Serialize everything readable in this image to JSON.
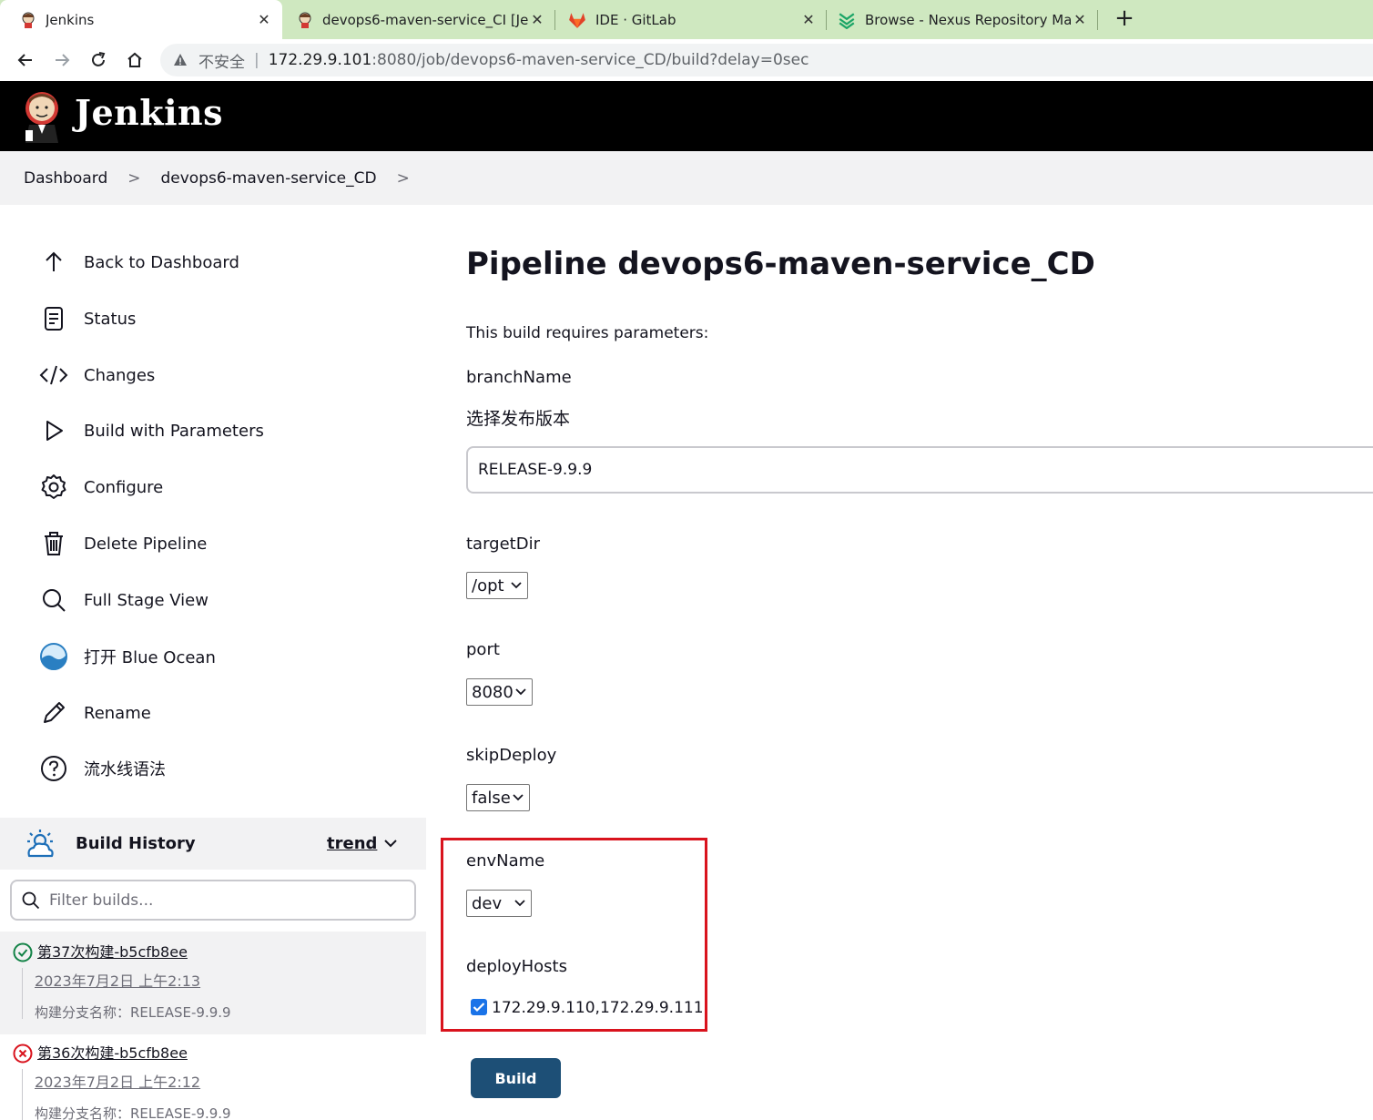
{
  "browser": {
    "tabs": [
      {
        "title": "Jenkins",
        "icon": "jenkins-favicon",
        "active": true
      },
      {
        "title": "devops6-maven-service_CI [Je",
        "icon": "jenkins-favicon",
        "active": false
      },
      {
        "title": "IDE · GitLab",
        "icon": "gitlab-favicon",
        "active": false
      },
      {
        "title": "Browse - Nexus Repository Ma",
        "icon": "nexus-favicon",
        "active": false
      }
    ],
    "new_tab": "+",
    "address": {
      "security_label": "不安全",
      "separator": "|",
      "host": "172.29.9.101",
      "path": ":8080/job/devops6-maven-service_CD/build?delay=0sec"
    }
  },
  "header": {
    "title": "Jenkins"
  },
  "breadcrumb": {
    "items": [
      "Dashboard",
      "devops6-maven-service_CD"
    ],
    "separator": ">"
  },
  "sidebar": {
    "items": [
      {
        "label": "Back to Dashboard",
        "icon": "arrow-up-icon"
      },
      {
        "label": "Status",
        "icon": "document-icon"
      },
      {
        "label": "Changes",
        "icon": "code-icon"
      },
      {
        "label": "Build with Parameters",
        "icon": "play-icon"
      },
      {
        "label": "Configure",
        "icon": "gear-icon"
      },
      {
        "label": "Delete Pipeline",
        "icon": "trash-icon"
      },
      {
        "label": "Full Stage View",
        "icon": "search-icon"
      },
      {
        "label": "打开 Blue Ocean",
        "icon": "blue-ocean-icon"
      },
      {
        "label": "Rename",
        "icon": "pencil-icon"
      },
      {
        "label": "流水线语法",
        "icon": "help-icon"
      }
    ]
  },
  "build_history": {
    "title": "Build History",
    "trend_label": "trend",
    "filter_placeholder": "Filter builds...",
    "builds": [
      {
        "name": "第37次构建-b5cfb8ee",
        "date": "2023年7月2日 上午2:13",
        "description": "构建分支名称：RELEASE-9.9.9",
        "status": "success"
      },
      {
        "name": "第36次构建-b5cfb8ee",
        "date": "2023年7月2日 上午2:12",
        "description": "构建分支名称：RELEASE-9.9.9",
        "status": "failed"
      }
    ]
  },
  "main": {
    "title": "Pipeline devops6-maven-service_CD",
    "intro": "This build requires parameters:",
    "params": {
      "branchName": {
        "label": "branchName",
        "description": "选择发布版本",
        "value": "RELEASE-9.9.9"
      },
      "targetDir": {
        "label": "targetDir",
        "selected": "/opt"
      },
      "port": {
        "label": "port",
        "selected": "8080"
      },
      "skipDeploy": {
        "label": "skipDeploy",
        "selected": "false"
      },
      "envName": {
        "label": "envName",
        "selected": "dev"
      },
      "deployHosts": {
        "label": "deployHosts",
        "option": "172.29.9.110,172.29.9.111",
        "checked": true
      }
    },
    "build_button": "Build"
  },
  "colors": {
    "tabstrip": "#cfe8c0",
    "header_bg": "#000000",
    "breadcrumb_bg": "#f2f2f3",
    "highlight_border": "#d9131d",
    "build_button": "#1d4f76",
    "success": "#138347",
    "failure": "#d9131d"
  }
}
